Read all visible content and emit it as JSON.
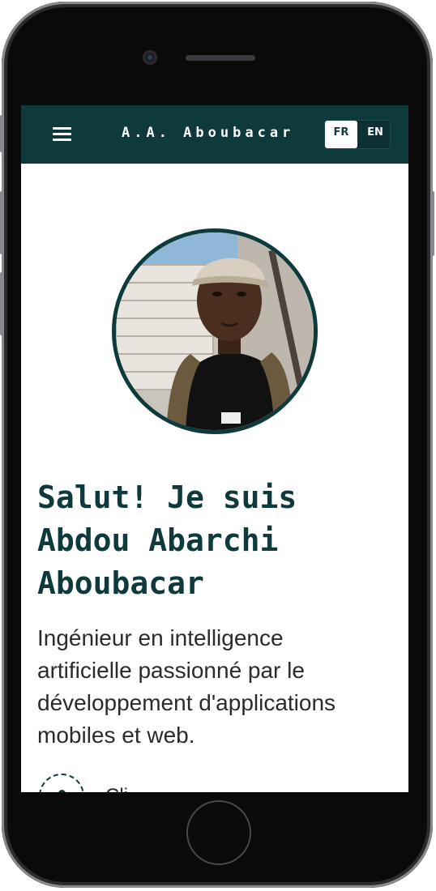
{
  "app": {
    "brand": "A.A. Aboubacar"
  },
  "navbar": {
    "menu_icon": "hamburger-menu-icon",
    "languages": [
      {
        "code": "FR",
        "active": true
      },
      {
        "code": "EN",
        "active": false
      }
    ]
  },
  "hero": {
    "profile_photo": "portrait-photo",
    "title": "Salut! Je suis\nAbdou Abarchi\nAboubacar",
    "subtitle": "Ingénieur en intelligence\nartificielle passionné par le\ndéveloppement d'applications\nmobiles et web.",
    "cta_partial_label": "Cli..."
  },
  "colors": {
    "accent": "#0f3a3c",
    "text": "#2b2b2b",
    "background": "#ffffff"
  }
}
